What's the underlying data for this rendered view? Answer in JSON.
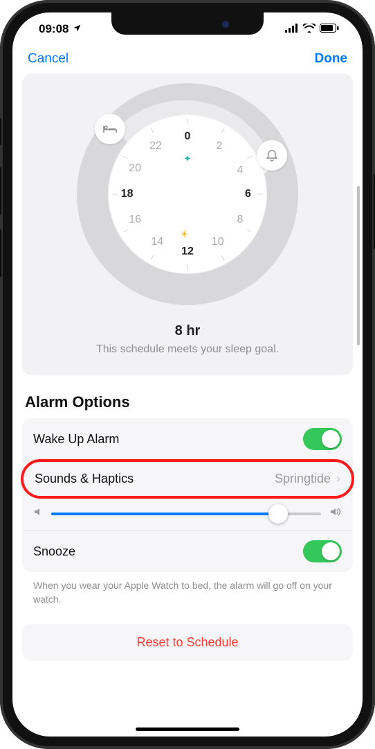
{
  "status": {
    "time": "09:08"
  },
  "nav": {
    "cancel": "Cancel",
    "done": "Done"
  },
  "dial": {
    "hours": [
      "0",
      "2",
      "4",
      "6",
      "8",
      "10",
      "12",
      "14",
      "16",
      "18",
      "20",
      "22"
    ],
    "duration": "8 hr",
    "goal_message": "This schedule meets your sleep goal."
  },
  "alarm": {
    "section_title": "Alarm Options",
    "wake_label": "Wake Up Alarm",
    "wake_enabled": true,
    "sounds_label": "Sounds & Haptics",
    "sounds_value": "Springtide",
    "volume_percent": 84,
    "snooze_label": "Snooze",
    "snooze_enabled": true,
    "footnote": "When you wear your Apple Watch to bed, the alarm will go off on your watch."
  },
  "reset_label": "Reset to Schedule",
  "colors": {
    "accent": "#007aff",
    "toggle_on": "#34c759",
    "danger": "#ff3b30",
    "highlight": "#ff1a1a"
  }
}
